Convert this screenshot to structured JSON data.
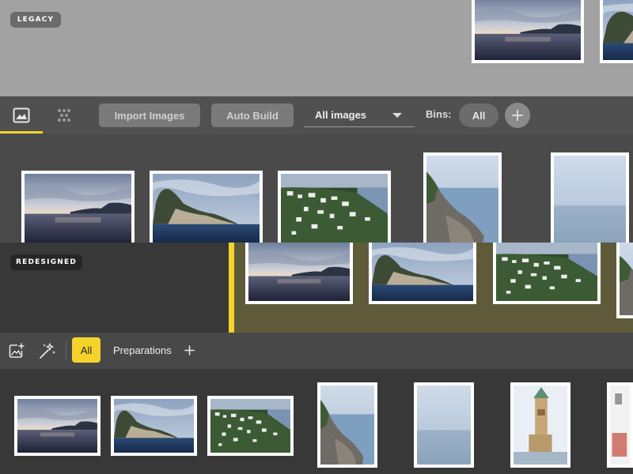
{
  "legacy": {
    "badge": "LEGACY",
    "toolbar": {
      "tabs": [
        {
          "icon": "image-icon",
          "active": true
        },
        {
          "icon": "dots-grid-icon",
          "active": false
        }
      ],
      "import_label": "Import Images",
      "autobuild_label": "Auto Build",
      "filter_selected": "All images",
      "bins_label": "Bins:",
      "bin_all_label": "All",
      "add_bin_icon": "plus-icon"
    }
  },
  "redesigned": {
    "badge": "REDESIGNED",
    "toolbar": {
      "import_icon": "add-image-icon",
      "autobuild_icon": "sparkle-wand-icon",
      "all_label": "All",
      "preparations_label": "Preparations",
      "add_icon": "plus-icon"
    }
  },
  "colors": {
    "accent": "#f5d32a",
    "drop_zone": "#5f5a3a"
  }
}
